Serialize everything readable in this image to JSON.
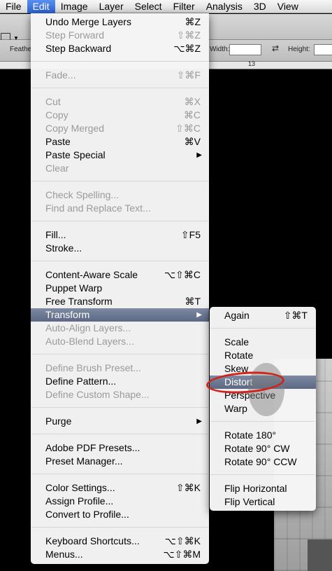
{
  "menubar": {
    "items": [
      "File",
      "Edit",
      "Image",
      "Layer",
      "Select",
      "Filter",
      "Analysis",
      "3D",
      "View"
    ]
  },
  "options_bar": {
    "feather_label": "Feathe",
    "width_label": "Width:",
    "height_label": "Height:",
    "ruler_mark": "13"
  },
  "edit_menu": {
    "items": [
      {
        "label": "Undo Merge Layers",
        "shortcut": "⌘Z"
      },
      {
        "label": "Step Forward",
        "shortcut": "⇧⌘Z"
      },
      {
        "label": "Step Backward",
        "shortcut": "⌥⌘Z"
      },
      {
        "label": "Fade...",
        "shortcut": "⇧⌘F"
      },
      {
        "label": "Cut",
        "shortcut": "⌘X"
      },
      {
        "label": "Copy",
        "shortcut": "⌘C"
      },
      {
        "label": "Copy Merged",
        "shortcut": "⇧⌘C"
      },
      {
        "label": "Paste",
        "shortcut": "⌘V"
      },
      {
        "label": "Paste Special",
        "shortcut": "▶"
      },
      {
        "label": "Clear",
        "shortcut": ""
      },
      {
        "label": "Check Spelling...",
        "shortcut": ""
      },
      {
        "label": "Find and Replace Text...",
        "shortcut": ""
      },
      {
        "label": "Fill...",
        "shortcut": "⇧F5"
      },
      {
        "label": "Stroke...",
        "shortcut": ""
      },
      {
        "label": "Content-Aware Scale",
        "shortcut": "⌥⇧⌘C"
      },
      {
        "label": "Puppet Warp",
        "shortcut": ""
      },
      {
        "label": "Free Transform",
        "shortcut": "⌘T"
      },
      {
        "label": "Transform",
        "shortcut": "▶"
      },
      {
        "label": "Auto-Align Layers...",
        "shortcut": ""
      },
      {
        "label": "Auto-Blend Layers...",
        "shortcut": ""
      },
      {
        "label": "Define Brush Preset...",
        "shortcut": ""
      },
      {
        "label": "Define Pattern...",
        "shortcut": ""
      },
      {
        "label": "Define Custom Shape...",
        "shortcut": ""
      },
      {
        "label": "Purge",
        "shortcut": "▶"
      },
      {
        "label": "Adobe PDF Presets...",
        "shortcut": ""
      },
      {
        "label": "Preset Manager...",
        "shortcut": ""
      },
      {
        "label": "Color Settings...",
        "shortcut": "⇧⌘K"
      },
      {
        "label": "Assign Profile...",
        "shortcut": ""
      },
      {
        "label": "Convert to Profile...",
        "shortcut": ""
      },
      {
        "label": "Keyboard Shortcuts...",
        "shortcut": "⌥⇧⌘K"
      },
      {
        "label": "Menus...",
        "shortcut": "⌥⇧⌘M"
      }
    ]
  },
  "transform_submenu": {
    "items": [
      {
        "label": "Again",
        "shortcut": "⇧⌘T"
      },
      {
        "label": "Scale",
        "shortcut": ""
      },
      {
        "label": "Rotate",
        "shortcut": ""
      },
      {
        "label": "Skew",
        "shortcut": ""
      },
      {
        "label": "Distort",
        "shortcut": ""
      },
      {
        "label": "Perspective",
        "shortcut": ""
      },
      {
        "label": "Warp",
        "shortcut": ""
      },
      {
        "label": "Rotate 180°",
        "shortcut": ""
      },
      {
        "label": "Rotate 90° CW",
        "shortcut": ""
      },
      {
        "label": "Rotate 90° CCW",
        "shortcut": ""
      },
      {
        "label": "Flip Horizontal",
        "shortcut": ""
      },
      {
        "label": "Flip Vertical",
        "shortcut": ""
      }
    ]
  },
  "colors": {
    "menu_highlight": "#3f66c4",
    "annotation_ring": "#d0231b"
  }
}
